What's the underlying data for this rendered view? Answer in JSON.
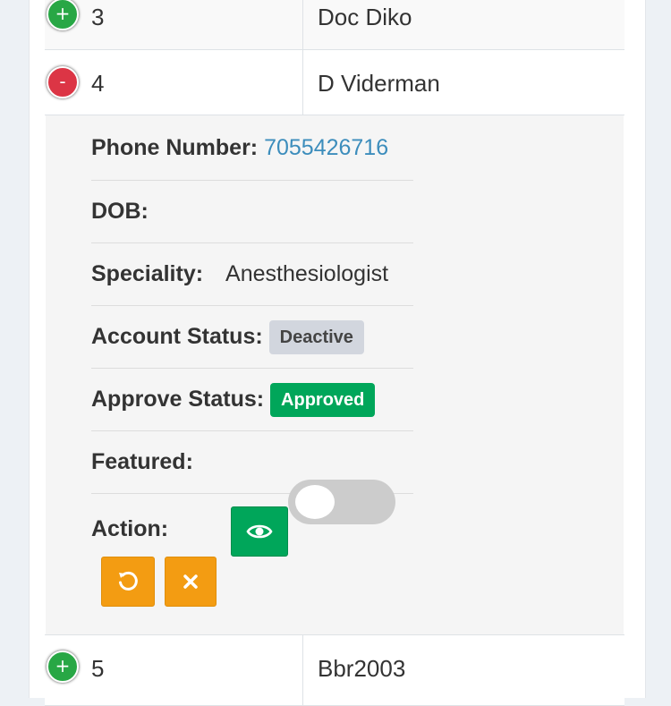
{
  "rows": [
    {
      "id": "3",
      "name": "Doc Diko",
      "expand_symbol": "+"
    },
    {
      "id": "4",
      "name": "D Viderman",
      "expand_symbol": "-"
    },
    {
      "id": "5",
      "name": "Bbr2003",
      "expand_symbol": "+"
    }
  ],
  "details": {
    "phone_label": "Phone Number:",
    "phone_value": "7055426716",
    "dob_label": "DOB:",
    "dob_value": "",
    "speciality_label": "Speciality:",
    "speciality_value": "Anesthesiologist",
    "account_status_label": "Account Status:",
    "account_status_value": "Deactive",
    "approve_status_label": "Approve Status:",
    "approve_status_value": "Approved",
    "featured_label": "Featured:",
    "featured_on": false,
    "action_label": "Action:"
  },
  "icons": {
    "view": "eye-icon",
    "restore": "undo-icon",
    "delete": "close-icon"
  },
  "colors": {
    "green": "#00a65a",
    "orange": "#f39c12",
    "red": "#dc3545",
    "link": "#3c8dbc",
    "badge_gray": "#d2d6de"
  }
}
